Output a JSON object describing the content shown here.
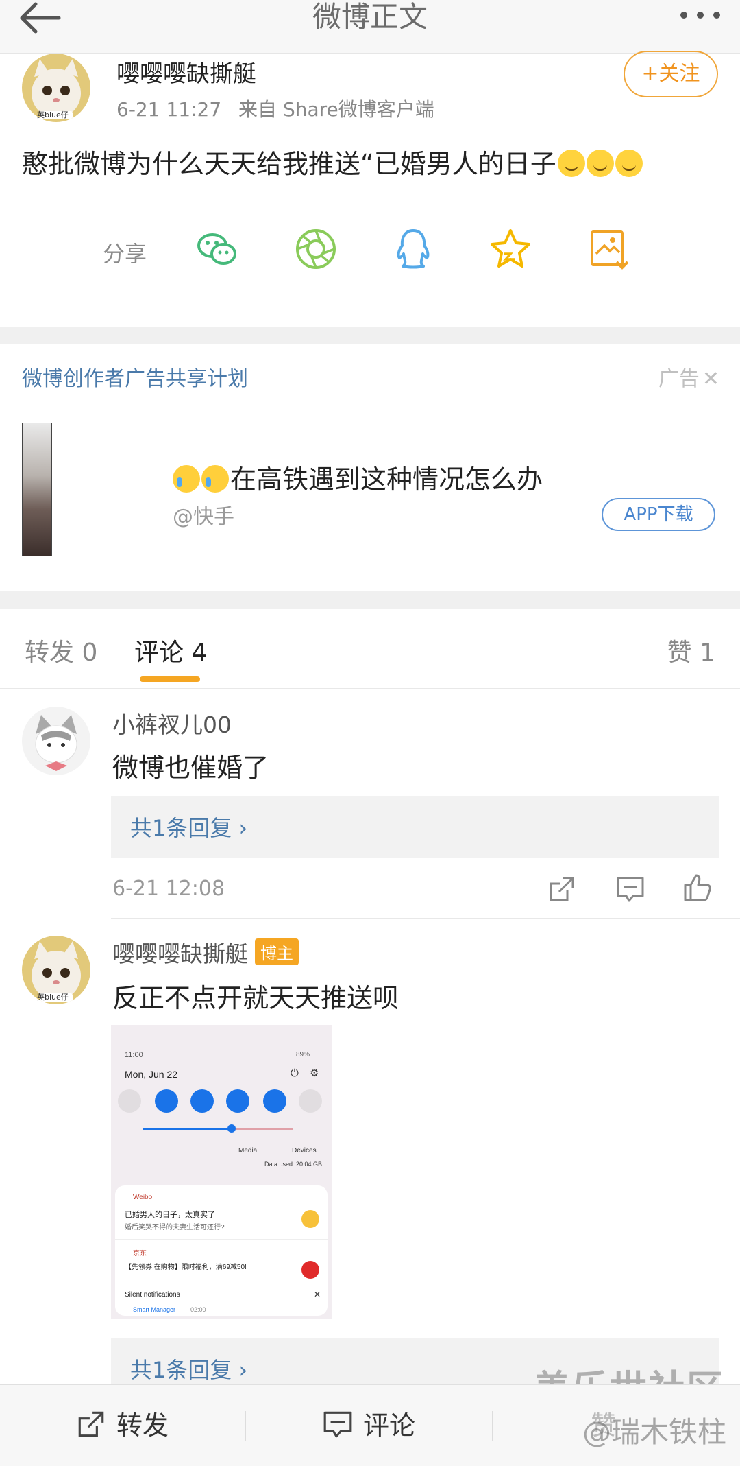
{
  "header": {
    "title": "微博正文"
  },
  "post": {
    "author": "嘤嘤嘤缺撕艇",
    "avatar_label": "英blue仔",
    "time": "6-21 11:27",
    "source": "来自 Share微博客户端",
    "follow_label": "+关注",
    "text": "憨批微博为什么天天给我推送“已婚男人的日子"
  },
  "share": {
    "label": "分享"
  },
  "ad": {
    "title": "微博创作者广告共享计划",
    "tag": "广告",
    "headline": "在高铁遇到这种情况怎么办",
    "source": "@快手",
    "button": "APP下载"
  },
  "tabs": {
    "repost": "转发 0",
    "comment": "评论 4",
    "like": "赞 1"
  },
  "comments": [
    {
      "name": "小裤衩儿00",
      "text": "微博也催婚了",
      "reply": "共1条回复 ›",
      "time": "6-21 12:08"
    },
    {
      "name": "嘤嘤嘤缺撕艇",
      "badge": "博主",
      "avatar_label": "英blue仔",
      "text": "反正不点开就天天推送呗",
      "reply": "共1条回复 ›"
    }
  ],
  "screenshot": {
    "time": "11:00",
    "battery": "89%",
    "date": "Mon, Jun 22",
    "media": "Media",
    "devices": "Devices",
    "data_used": "Data used: 20.04 GB",
    "n1_app": "Weibo",
    "n1_title": "已婚男人的日子，太真实了",
    "n1_body": "婚后笑哭不得的夫妻生活可还行?",
    "n2_app": "京东",
    "n2_body": "【先领券 在购物】限时福利，满69减50!",
    "silent": "Silent notifications",
    "n3_app": "Smart Manager",
    "n3_time": "02:00"
  },
  "bottom": {
    "repost": "转发",
    "comment": "评论",
    "like": "赞"
  },
  "watermark": {
    "line1": "盖乐世社区",
    "line2": "@瑞木铁柱"
  }
}
